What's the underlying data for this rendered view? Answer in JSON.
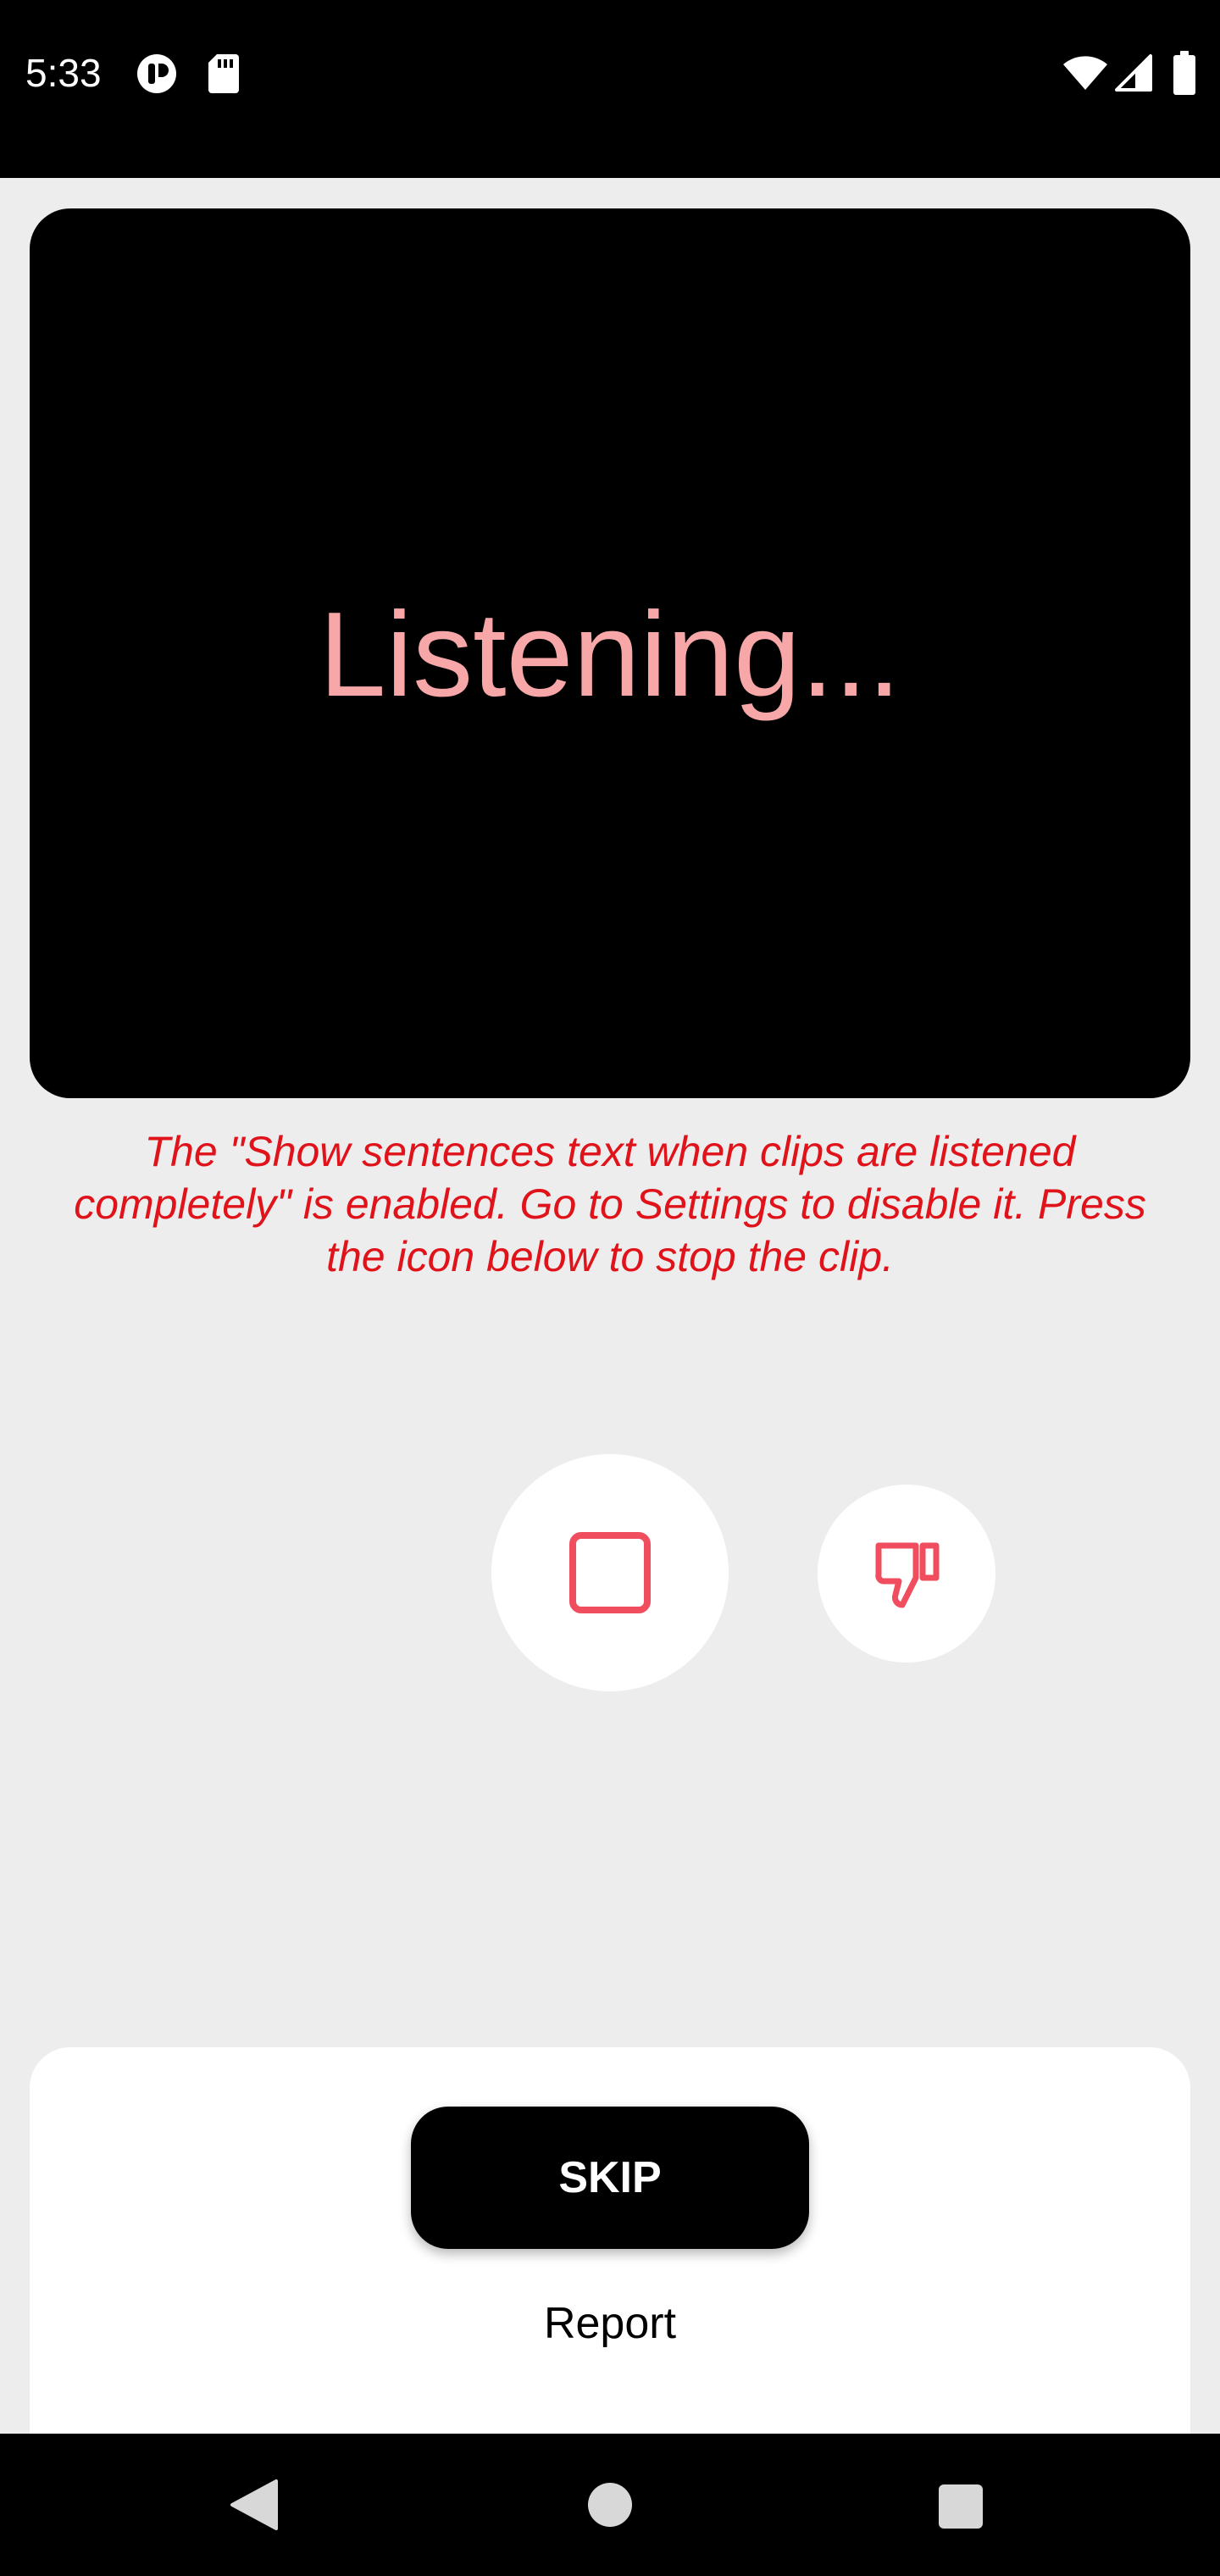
{
  "status_bar": {
    "time": "5:33",
    "icons": [
      "app-notification-icon",
      "sd-card-icon",
      "wifi-icon",
      "cell-signal-icon",
      "battery-icon"
    ]
  },
  "prompt": {
    "text": "Listening..."
  },
  "info": {
    "message": "The \"Show sentences text when clips are listened completely\" is enabled. Go to Settings to disable it. Press the icon below to stop the clip."
  },
  "controls": {
    "stop_icon": "stop-icon",
    "dislike_icon": "thumbs-down-icon"
  },
  "bottom_sheet": {
    "skip_label": "SKIP",
    "report_label": "Report"
  },
  "nav_bar": {
    "icons": [
      "back-icon",
      "home-icon",
      "recents-icon"
    ]
  },
  "colors": {
    "accent": "#f04e5e",
    "prompt_text": "#f7a7a7",
    "info_text": "#e0121a",
    "background": "#ededed"
  }
}
